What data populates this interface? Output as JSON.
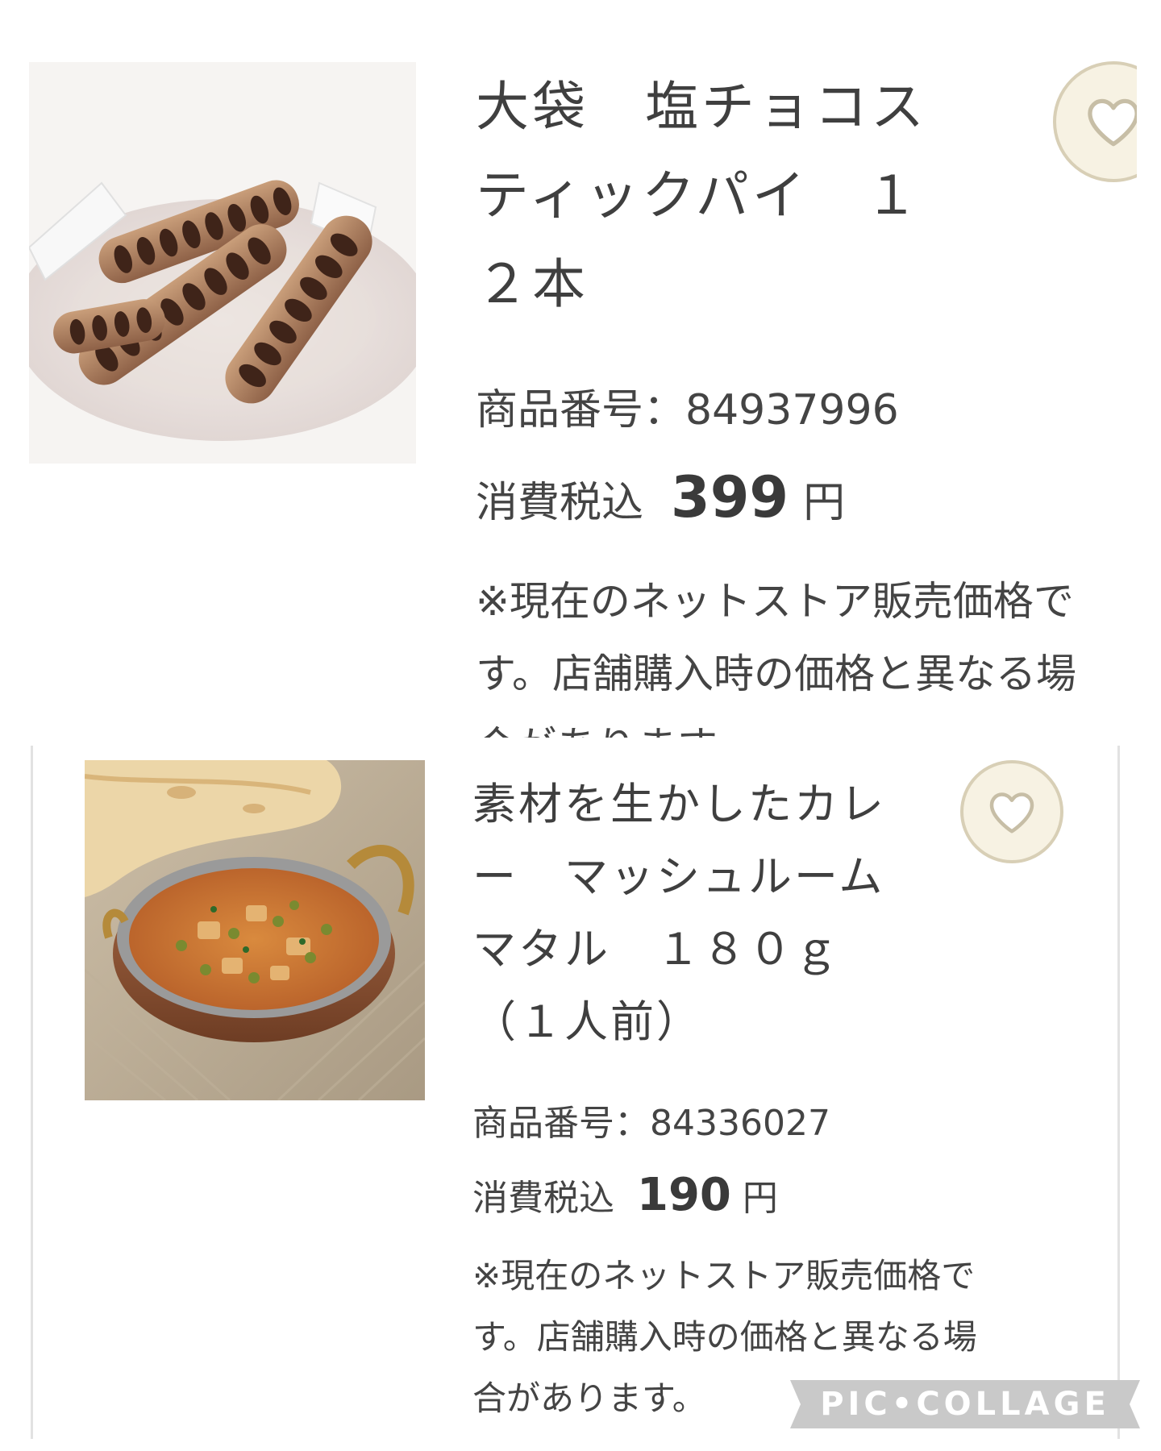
{
  "products": [
    {
      "title": "大袋　塩チョコスティックパイ　１２本",
      "number_label": "商品番号：",
      "number": "84937996",
      "price_label": "消費税込",
      "price": "399",
      "currency": "円",
      "note": "※現在のネットストア販売価格です。店舗購入時の価格と異なる場合があります。",
      "note_lines": [
        "※現在のネットストア販売価格で",
        "す。店舗購入時の価格と異なる場",
        "合があります。"
      ],
      "favorite_icon": "heart-icon"
    },
    {
      "title": "素材を生かしたカレー　マッシュルームマタル　１８０ｇ（１人前）",
      "title_lines": [
        "素材を生かしたカレ",
        "ー　マッシュルーム",
        "マタル　１８０ｇ",
        "（１人前）"
      ],
      "number_label": "商品番号：",
      "number": "84336027",
      "price_label": "消費税込",
      "price": "190",
      "currency": "円",
      "note": "※現在のネットストア販売価格です。店舗購入時の価格と異なる場合があります。",
      "note_lines": [
        "※現在のネットストア販売価格で",
        "す。店舗購入時の価格と異なる場",
        "合があります。"
      ],
      "favorite_icon": "heart-icon"
    }
  ],
  "watermark": "PIC•COLLAGE",
  "colors": {
    "text": "#3b3b3b",
    "favorite_bg": "#f7f2e3",
    "favorite_border": "#d8cfb6",
    "watermark_bg": "#c9c9c9"
  }
}
